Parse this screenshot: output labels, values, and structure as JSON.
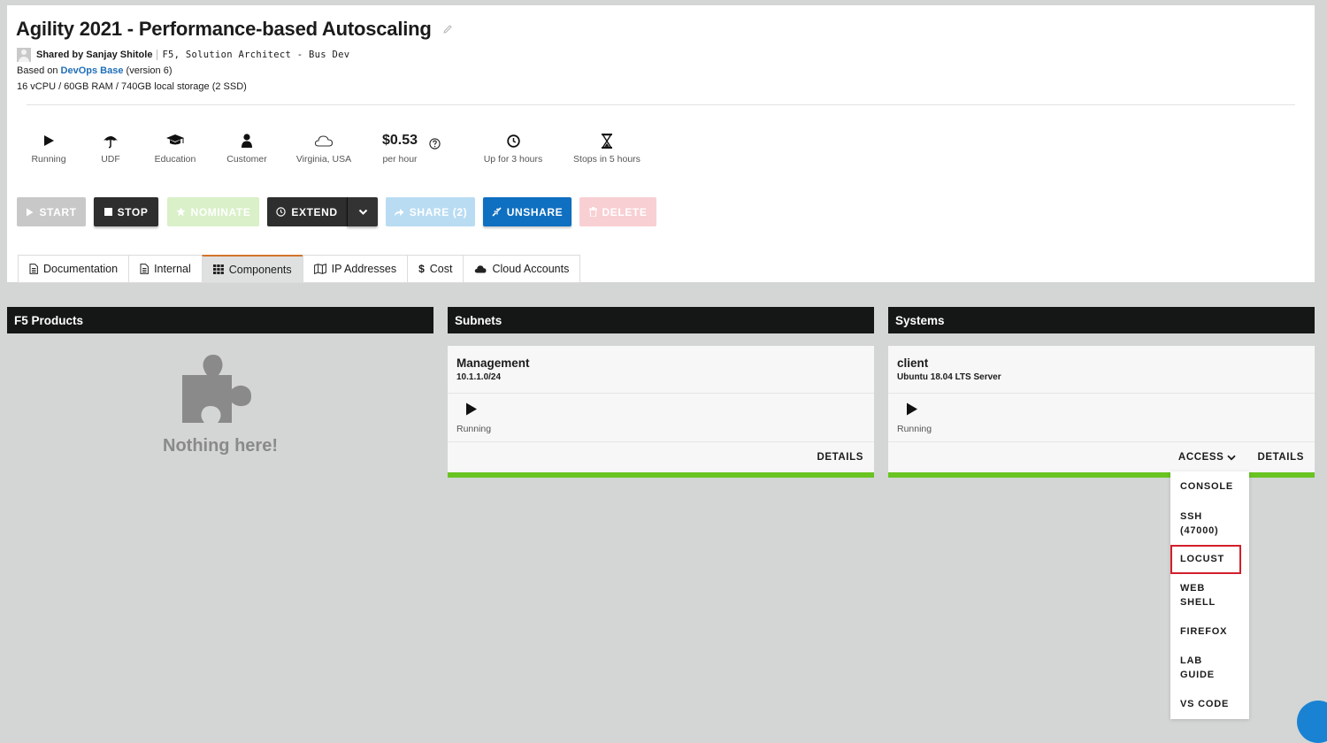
{
  "header": {
    "title": "Agility 2021 - Performance-based Autoscaling",
    "shared_by": "Shared by Sanjay Shitole",
    "shared_role": "F5, Solution Architect - Bus Dev",
    "based_on_prefix": "Based on",
    "based_on_link": "DevOps Base",
    "based_on_suffix": "(version 6)",
    "specs": "16 vCPU / 60GB RAM / 740GB local storage (2 SSD)"
  },
  "stats": {
    "state": "Running",
    "platform": "UDF",
    "type": "Education",
    "audience": "Customer",
    "region": "Virginia, USA",
    "price": "$0.53",
    "price_unit": "per hour",
    "uptime": "Up for 3 hours",
    "stops": "Stops in 5 hours"
  },
  "actions": {
    "start": "START",
    "stop": "STOP",
    "nominate": "NOMINATE",
    "extend": "EXTEND",
    "share": "SHARE (2)",
    "unshare": "UNSHARE",
    "delete": "DELETE"
  },
  "tabs": [
    {
      "label": "Documentation",
      "icon": "document-icon"
    },
    {
      "label": "Internal",
      "icon": "document-icon"
    },
    {
      "label": "Components",
      "icon": "grid-icon",
      "active": true
    },
    {
      "label": "IP Addresses",
      "icon": "map-icon"
    },
    {
      "label": "Cost",
      "icon": "dollar-icon"
    },
    {
      "label": "Cloud Accounts",
      "icon": "cloud-icon"
    }
  ],
  "columns": {
    "f5_products": {
      "title": "F5 Products",
      "empty_text": "Nothing here!"
    },
    "subnets": {
      "title": "Subnets",
      "card": {
        "name": "Management",
        "sub": "10.1.1.0/24",
        "status": "Running",
        "details": "DETAILS"
      }
    },
    "systems": {
      "title": "Systems",
      "card": {
        "name": "client",
        "sub": "Ubuntu 18.04 LTS Server",
        "status": "Running",
        "access": "ACCESS",
        "details": "DETAILS"
      }
    }
  },
  "access_menu": {
    "items": [
      "CONSOLE",
      "SSH (47000)",
      "LOCUST",
      "WEB SHELL",
      "FIREFOX",
      "LAB GUIDE",
      "VS CODE"
    ],
    "highlighted": "LOCUST"
  },
  "colors": {
    "running_bar": "#69c322",
    "unshare": "#0f6fc0",
    "highlight": "#d21f2a",
    "active_tab_accent": "#d3732a"
  }
}
